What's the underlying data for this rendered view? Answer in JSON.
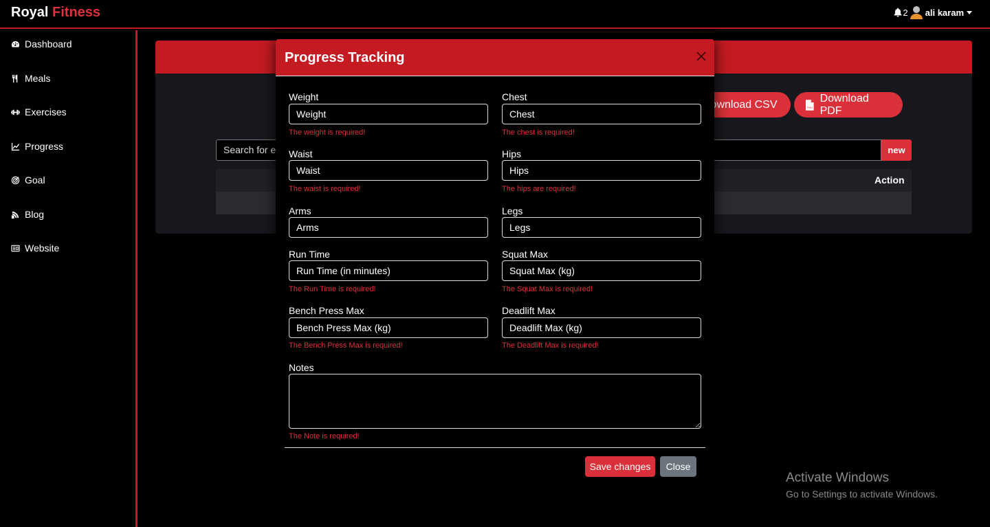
{
  "brand": {
    "name": "Royal",
    "accent": "Fitness"
  },
  "header": {
    "notif_count": "2",
    "username": "ali karam"
  },
  "sidebar": {
    "items": [
      {
        "label": "Dashboard",
        "icon": "gauge-icon"
      },
      {
        "label": "Meals",
        "icon": "utensils-icon"
      },
      {
        "label": "Exercises",
        "icon": "dumbbell-icon"
      },
      {
        "label": "Progress",
        "icon": "chart-line-icon"
      },
      {
        "label": "Goal",
        "icon": "target-icon"
      },
      {
        "label": "Blog",
        "icon": "blog-icon"
      },
      {
        "label": "Website",
        "icon": "website-icon"
      }
    ]
  },
  "main": {
    "download_csv": "Download CSV",
    "download_pdf": "Download PDF",
    "search_placeholder": "Search for exercises...",
    "search_visible": "Search for ex",
    "new_button": "new",
    "table_action_header": "Action"
  },
  "modal": {
    "title": "Progress Tracking",
    "fields": {
      "weight": {
        "label": "Weight",
        "placeholder": "Weight",
        "error": "The weight is required!"
      },
      "chest": {
        "label": "Chest",
        "placeholder": "Chest",
        "error": "The chest is required!"
      },
      "waist": {
        "label": "Waist",
        "placeholder": "Waist",
        "error": "The waist is required!"
      },
      "hips": {
        "label": "Hips",
        "placeholder": "Hips",
        "error": "The hips are required!"
      },
      "arms": {
        "label": "Arms",
        "placeholder": "Arms"
      },
      "legs": {
        "label": "Legs",
        "placeholder": "Legs"
      },
      "run_time": {
        "label": "Run Time",
        "placeholder": "Run Time (in minutes)",
        "error": "The Run Time is required!"
      },
      "squat_max": {
        "label": "Squat Max",
        "placeholder": "Squat Max (kg)",
        "error": "The Squat Max is required!"
      },
      "bench_press_max": {
        "label": "Bench Press Max",
        "placeholder": "Bench Press Max (kg)",
        "error": "The Bench Press Max is required!"
      },
      "deadlift_max": {
        "label": "Deadlift Max",
        "placeholder": "Deadlift Max (kg)",
        "error": "The Deadlift Max is required!"
      },
      "notes": {
        "label": "Notes",
        "error": "The Note is required!"
      }
    },
    "save_button": "Save changes",
    "close_button": "Close"
  },
  "watermark": {
    "title": "Activate Windows",
    "subtitle": "Go to Settings to activate Windows."
  },
  "colors": {
    "accent": "#c41a22",
    "button_red": "#d93039",
    "button_gray": "#6c757d",
    "error": "#e0303b"
  }
}
